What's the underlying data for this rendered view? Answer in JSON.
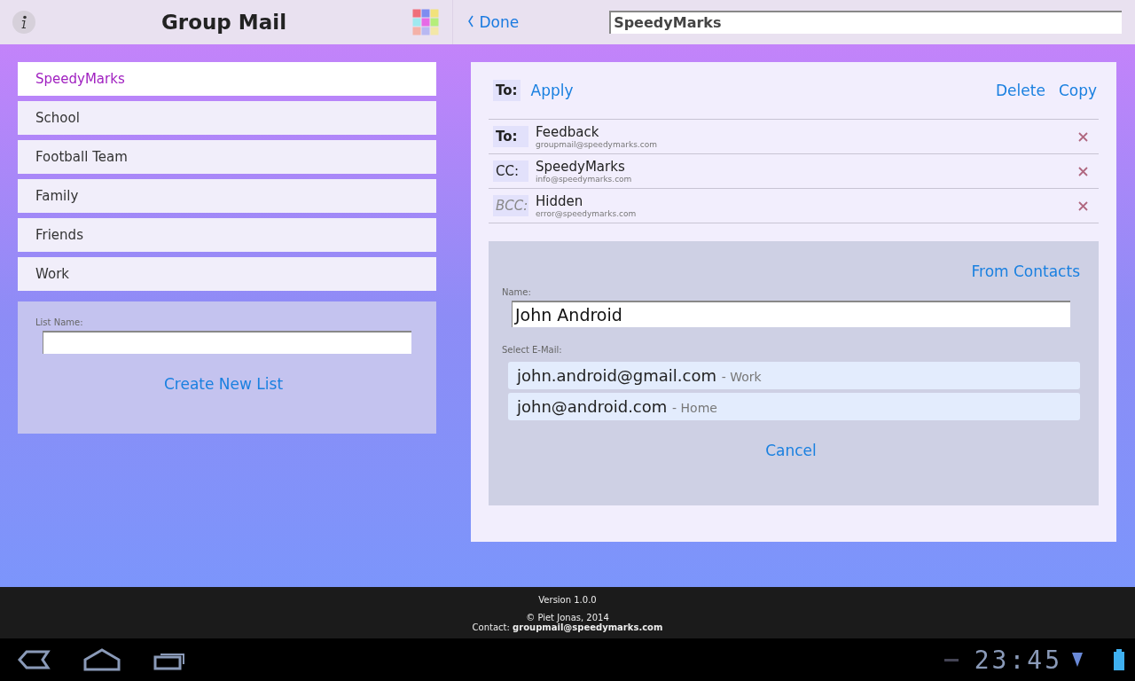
{
  "header": {
    "title": "Group Mail",
    "done": "Done",
    "list_title": "SpeedyMarks"
  },
  "lists": [
    {
      "label": "SpeedyMarks",
      "selected": true
    },
    {
      "label": "School",
      "selected": false
    },
    {
      "label": "Football Team",
      "selected": false
    },
    {
      "label": "Family",
      "selected": false
    },
    {
      "label": "Friends",
      "selected": false
    },
    {
      "label": "Work",
      "selected": false
    }
  ],
  "new_list": {
    "label": "List Name:",
    "button": "Create New List"
  },
  "editor": {
    "to_label": "To:",
    "apply": "Apply",
    "delete": "Delete",
    "copy": "Copy",
    "recipients": [
      {
        "kind": "to",
        "label": "To:",
        "name": "Feedback",
        "email": "groupmail@speedymarks.com"
      },
      {
        "kind": "cc",
        "label": "CC:",
        "name": "SpeedyMarks",
        "email": "info@speedymarks.com"
      },
      {
        "kind": "bcc",
        "label": "BCC:",
        "name": "Hidden",
        "email": "error@speedymarks.com"
      }
    ],
    "from_contacts": "From Contacts",
    "name_label": "Name:",
    "name_value": "John Android",
    "email_label": "Select E-Mail:",
    "emails": [
      {
        "address": "john.android@gmail.com",
        "type": "- Work"
      },
      {
        "address": "john@android.com",
        "type": "- Home"
      }
    ],
    "cancel": "Cancel"
  },
  "footer": {
    "version": "Version 1.0.0",
    "copyright": "© Piet Jonas, 2014",
    "contact_label": "Contact:",
    "contact_email": "groupmail@speedymarks.com"
  },
  "system_bar": {
    "time": "23:45"
  }
}
